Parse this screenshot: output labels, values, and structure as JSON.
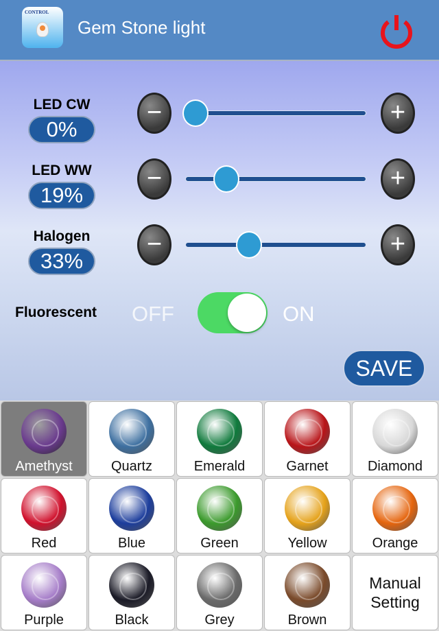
{
  "header": {
    "title": "Gem Stone light",
    "app_icon_brand": "CONTROL",
    "power_color": "#e8141c"
  },
  "sliders": [
    {
      "label": "LED CW",
      "value": 0,
      "display": "0%"
    },
    {
      "label": "LED WW",
      "value": 19,
      "display": "19%"
    },
    {
      "label": "Halogen",
      "value": 33,
      "display": "33%"
    }
  ],
  "buttons": {
    "minus": "−",
    "plus": "+",
    "save": "SAVE"
  },
  "fluorescent": {
    "label": "Fluorescent",
    "off": "OFF",
    "on": "ON",
    "state": "on"
  },
  "gems": [
    {
      "name": "Amethyst",
      "color": "#6a3a8e",
      "selected": true
    },
    {
      "name": "Quartz",
      "color": "#3d6fa0"
    },
    {
      "name": "Emerald",
      "color": "#0f7a3c"
    },
    {
      "name": "Garnet",
      "color": "#b81418"
    },
    {
      "name": "Diamond",
      "color": "#d8d8d8"
    },
    {
      "name": "Red",
      "color": "#d0102c"
    },
    {
      "name": "Blue",
      "color": "#1c3d9c"
    },
    {
      "name": "Green",
      "color": "#3b9a2c"
    },
    {
      "name": "Yellow",
      "color": "#e5a21a"
    },
    {
      "name": "Orange",
      "color": "#e5650e"
    },
    {
      "name": "Purple",
      "color": "#a57cc8"
    },
    {
      "name": "Black",
      "color": "#1a1a26"
    },
    {
      "name": "Grey",
      "color": "#6a6a6a"
    },
    {
      "name": "Brown",
      "color": "#7a4a2a"
    }
  ],
  "manual": {
    "line1": "Manual",
    "line2": "Setting"
  }
}
